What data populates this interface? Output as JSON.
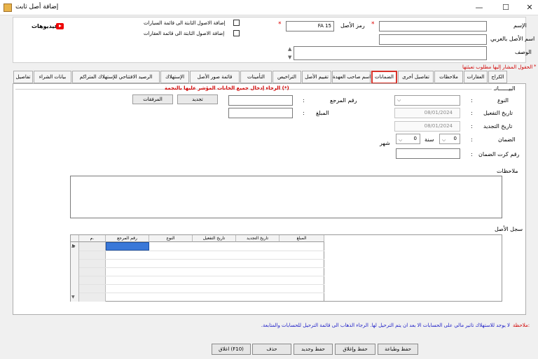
{
  "window": {
    "title": "إضافة أصل ثابت",
    "minimize": "—",
    "maximize": "☐",
    "close": "✕"
  },
  "header": {
    "name_label": "الإسم",
    "asset_code_label": "رمز الأصل",
    "asset_code_value": "FA 15",
    "arabic_name_label": "اسم الأصل بالعربي",
    "description_label": "الوصف",
    "add_to_cars": "إضافة الاصول الثابتة الى قائمة السيارات",
    "add_to_real_estate": "إضافة الاصول الثابتة الى قائمة العقارات",
    "videos": "فيديوهات",
    "required_note": "الحقول المشار إليها مطلوب تعبئتها",
    "required_mark": "*"
  },
  "tabs": [
    {
      "label": "الكراج"
    },
    {
      "label": "العقارات"
    },
    {
      "label": "ملاحظات"
    },
    {
      "label": "تفاصيل أخرى"
    },
    {
      "label": "الضمانات"
    },
    {
      "label": "اسم صاحب العهدة"
    },
    {
      "label": "تقييم الأصل"
    },
    {
      "label": "التراخيص"
    },
    {
      "label": "التأمينات"
    },
    {
      "label": "قائمة صور الأصل"
    },
    {
      "label": "الإستهلاك"
    },
    {
      "label": "الرصيد الافتتاحي للإستهلاك المتراكم"
    },
    {
      "label": "بيانات الشراء"
    },
    {
      "label": "تفاصيل"
    }
  ],
  "warranty": {
    "section_label": "البيــــــانـ",
    "warning": "الرجاء إدخال جميع الخانات المؤشر عليها بالنجمة (*)",
    "type_label": "النوع",
    "ref_label": "رقم المرجع",
    "activation_date_label": "تاريخ التفعيل",
    "activation_date_value": "08/01/2024",
    "amount_label": "المبلغ",
    "renewal_date_label": "تاريخ التجديد",
    "renewal_date_value": "08/01/2024",
    "warranty_label": "الضمان",
    "years_value": "0",
    "years_label": "سنة",
    "months_value": "0",
    "months_label": "شهر",
    "card_label": "رقم كرت الضمان",
    "notes_label": "ملاحظات",
    "renew_button": "تجديد",
    "attachments_button": "المرفقات",
    "colon": ":",
    "log_label": "سجل الأصل",
    "grid_headers": [
      "م.",
      "رقم المرجع",
      "النوع",
      "تاريخ التفعيل",
      "تاريخ التجديد",
      "المبلغ"
    ]
  },
  "footer": {
    "note_label": "ملاحظة:",
    "note_text": "لا يوجد للاستهلاك تأثير مالي على الحسابات الا بعد ان يتم الترحيل لها. الرجاء الذهاب الى قائمة الترحيل للحسابات والمتابعة."
  },
  "buttons": {
    "save_print": "حفظ وطباعة",
    "save_close": "حفظ وإغلاق",
    "save_new": "حفظ وجديد",
    "delete": "حذف",
    "close": "اغلاق (F10)"
  },
  "colors": {
    "accent_red": "#d9342b",
    "note_blue": "#2020c8",
    "required_red": "#d10000"
  }
}
